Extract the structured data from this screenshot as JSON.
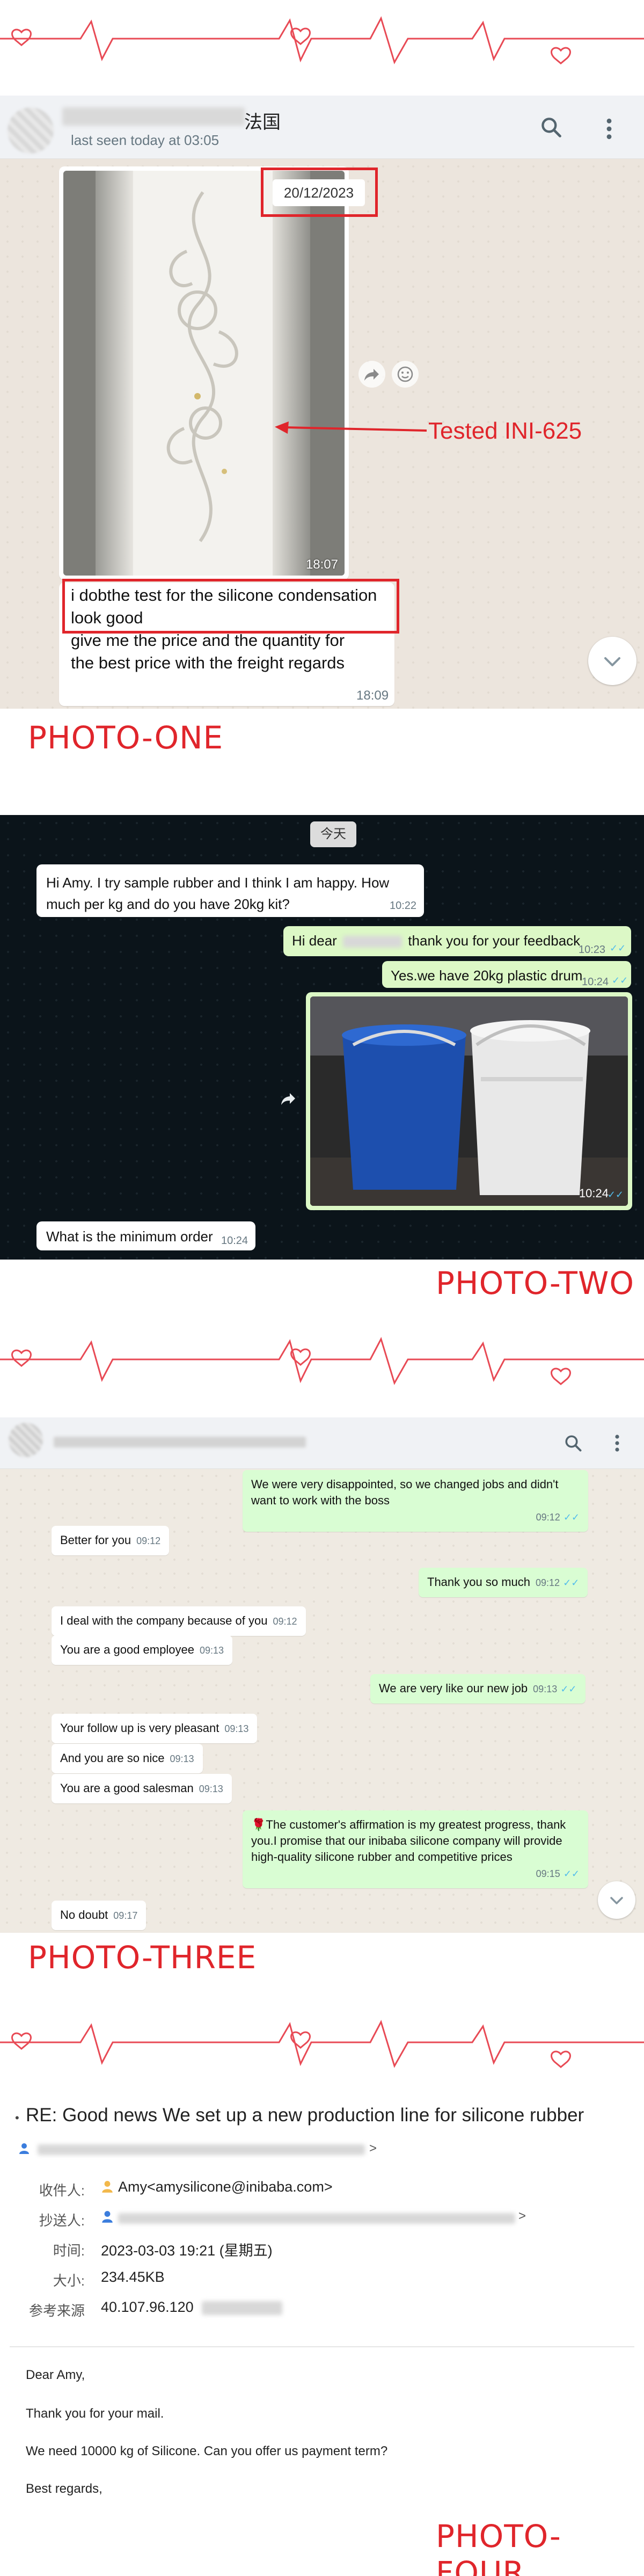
{
  "photo_one": {
    "contact_suffix": "法国",
    "last_seen": "last seen today at 03:05",
    "date_label": "20/12/2023",
    "image_time": "18:07",
    "annotation": "Tested INI-625",
    "message_highlight": "i dobthe test for the silicone condensation look good",
    "message_rest": "give me the price and the quantity for the best price with the freight regards",
    "message_time": "18:09",
    "caption": "PHOTO-ONE"
  },
  "photo_two": {
    "day_label": "今天",
    "msg_in_1": "Hi Amy. I try sample rubber and I think I am happy. How much per kg and do you have 20kg kit?",
    "msg_in_1_time": "10:22",
    "msg_out_1_prefix": "Hi dear",
    "msg_out_1_suffix": "thank you for your feedback",
    "msg_out_1_time": "10:23",
    "msg_out_2": "Yes.we have 20kg plastic drum",
    "msg_out_2_time": "10:24",
    "media_time": "10:24",
    "msg_in_2": "What is the minimum order",
    "msg_in_2_time": "10:24",
    "caption": "PHOTO-TWO"
  },
  "photo_three": {
    "messages": [
      {
        "text": "We were very disappointed, so we changed jobs and didn't want to work with the boss",
        "time": "09:12"
      },
      {
        "text": "Better for you",
        "time": "09:12"
      },
      {
        "text": "Thank you so much",
        "time": "09:12"
      },
      {
        "text": "I deal with the company because of you",
        "time": "09:12"
      },
      {
        "text": "You are a good employee",
        "time": "09:13"
      },
      {
        "text": "We are very like our new job",
        "time": "09:13"
      },
      {
        "text": "Your follow up is very pleasant",
        "time": "09:13"
      },
      {
        "text": "And you are so nice",
        "time": "09:13"
      },
      {
        "text": "You are a good salesman",
        "time": "09:13"
      },
      {
        "text": "🌹The customer's affirmation is my greatest progress, thank you.I promise that our inibaba silicone company will provide high-quality silicone rubber and competitive prices",
        "time": "09:15"
      },
      {
        "text": "No doubt",
        "time": "09:17"
      }
    ],
    "caption": "PHOTO-THREE"
  },
  "photo_four": {
    "subject": "RE: Good news We set up a new production line for silicone rubber",
    "from_suffix": ">",
    "to_label": "收件人:",
    "to_value": "Amy<amysilicone@inibaba.com>",
    "cc_label": "抄送人:",
    "cc_suffix": ">",
    "time_label": "时间:",
    "time_value": "2023-03-03 19:21 (星期五)",
    "size_label": "大小:",
    "size_value": "234.45KB",
    "source_label": "参考来源",
    "source_value": "40.107.96.120",
    "body_greeting": "Dear Amy,",
    "body_line1": "Thank you for your mail.",
    "body_line2": "We need 10000 kg of Silicone. Can you offer us payment term?",
    "body_closing": "Best regards,",
    "caption": "PHOTO-FOUR"
  },
  "colors": {
    "accent_red": "#e0252b",
    "whatsapp_out": "#dcf8c6",
    "whatsapp_dark_bg": "#0b141a",
    "read_tick": "#53bdeb"
  }
}
